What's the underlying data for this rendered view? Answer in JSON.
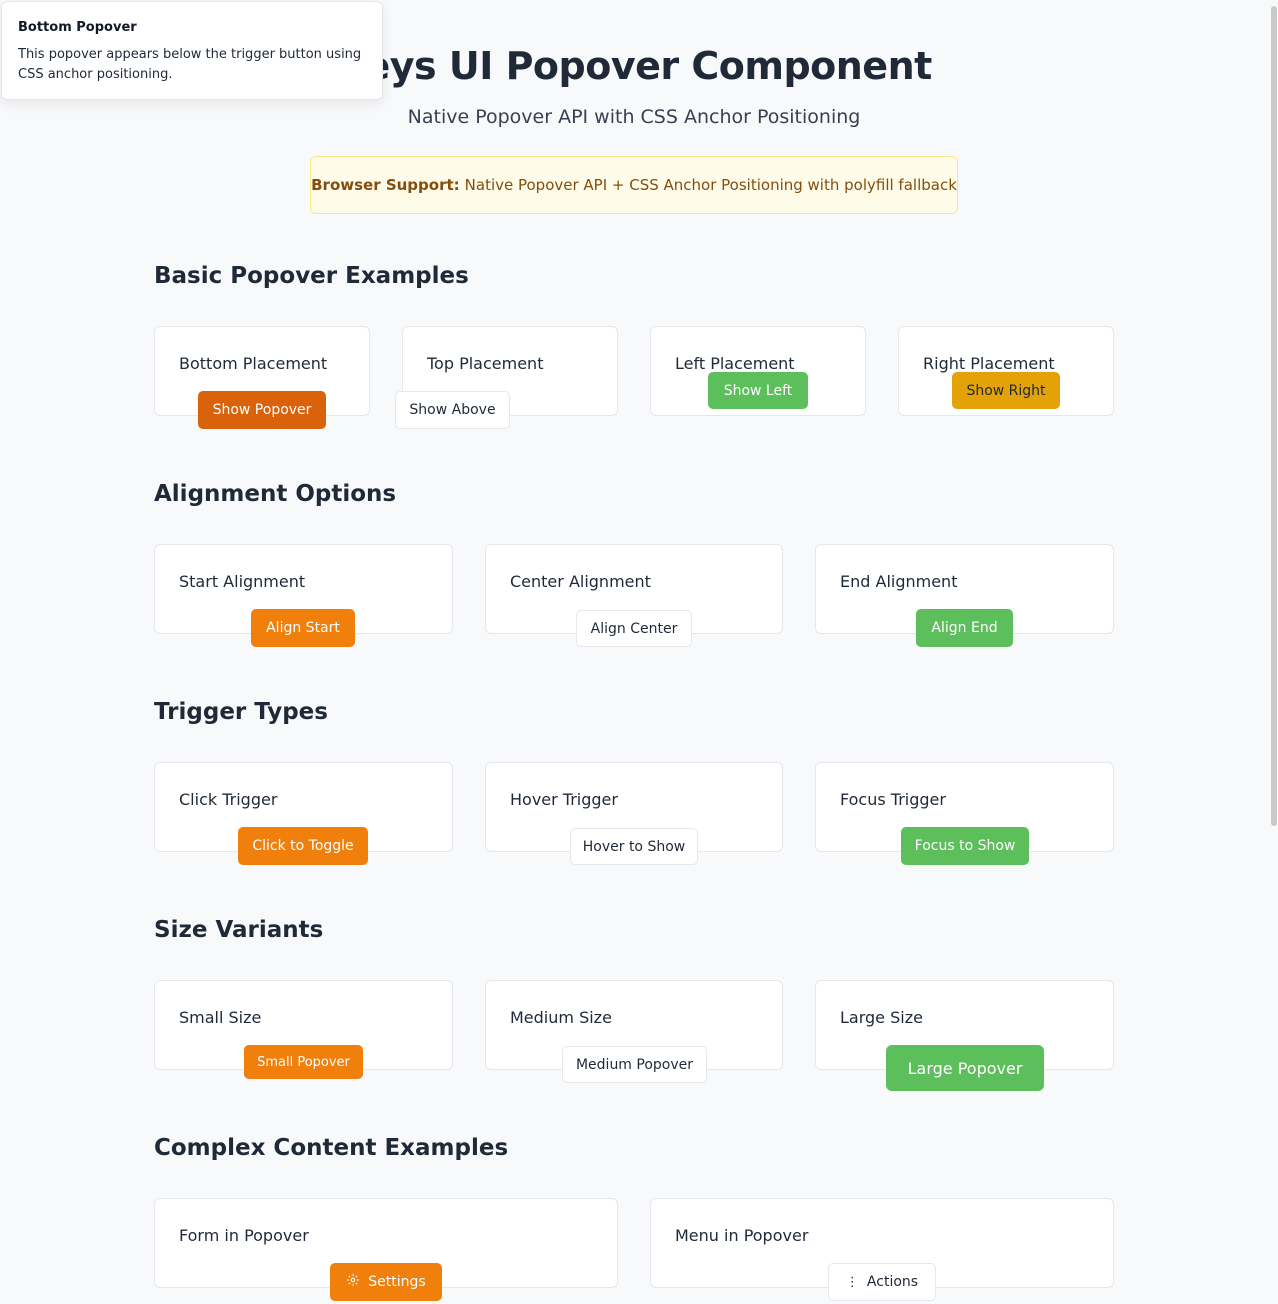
{
  "header": {
    "title": "Keys UI Popover Component",
    "subtitle": "Native Popover API with CSS Anchor Positioning",
    "support_label": "Browser Support:",
    "support_text": "Native Popover API + CSS Anchor Positioning with polyfill fallback"
  },
  "popover": {
    "title": "Bottom Popover",
    "body": "This popover appears below the trigger button using CSS anchor positioning."
  },
  "sections": {
    "basic": {
      "title": "Basic Popover Examples",
      "cards": [
        {
          "label": "Bottom Placement",
          "button": "Show Popover"
        },
        {
          "label": "Top Placement",
          "button": "Show Above"
        },
        {
          "label": "Left Placement",
          "button": "Show Left"
        },
        {
          "label": "Right Placement",
          "button": "Show Right"
        }
      ]
    },
    "alignment": {
      "title": "Alignment Options",
      "cards": [
        {
          "label": "Start Alignment",
          "button": "Align Start"
        },
        {
          "label": "Center Alignment",
          "button": "Align Center"
        },
        {
          "label": "End Alignment",
          "button": "Align End"
        }
      ]
    },
    "triggers": {
      "title": "Trigger Types",
      "cards": [
        {
          "label": "Click Trigger",
          "button": "Click to Toggle"
        },
        {
          "label": "Hover Trigger",
          "button": "Hover to Show"
        },
        {
          "label": "Focus Trigger",
          "button": "Focus to Show"
        }
      ]
    },
    "sizes": {
      "title": "Size Variants",
      "cards": [
        {
          "label": "Small Size",
          "button": "Small Popover"
        },
        {
          "label": "Medium Size",
          "button": "Medium Popover"
        },
        {
          "label": "Large Size",
          "button": "Large Popover"
        }
      ]
    },
    "complex": {
      "title": "Complex Content Examples",
      "cards": [
        {
          "label": "Form in Popover",
          "button": "Settings",
          "icon": "gear-icon"
        },
        {
          "label": "Menu in Popover",
          "button": "Actions",
          "icon": "vertical-dots-icon"
        }
      ]
    }
  },
  "colors": {
    "orange": "#f07f0c",
    "orange_dark": "#d9620b",
    "green": "#5cbf5b",
    "yellow": "#e3a308",
    "banner_bg": "#fefce8",
    "banner_text": "#854d0e"
  }
}
